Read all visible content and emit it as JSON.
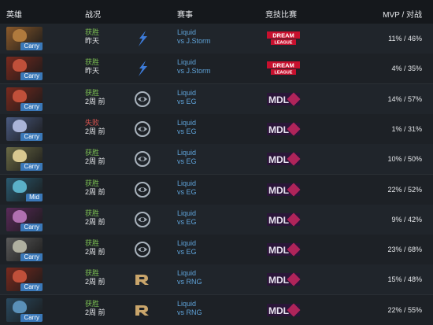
{
  "header": {
    "hero": "英雄",
    "record": "战况",
    "event": "赛事",
    "match": "竞技比赛",
    "mvp": "MVP / 对战"
  },
  "rows": [
    {
      "role": "Carry",
      "result": "获胜",
      "result_type": "win",
      "date": "昨天",
      "team": "Liquid",
      "vs": "vs J.Storm",
      "league": "dream-league",
      "mvp": "11% / 46%",
      "hero_color": "#8b5a2b",
      "face_color": "#b07a3d",
      "team_icon": "jstorm"
    },
    {
      "role": "Carry",
      "result": "获胜",
      "result_type": "win",
      "date": "昨天",
      "team": "Liquid",
      "vs": "vs J.Storm",
      "league": "dream-league",
      "mvp": "4% / 35%",
      "hero_color": "#7a2a1e",
      "face_color": "#c0503a",
      "team_icon": "jstorm"
    },
    {
      "role": "Carry",
      "result": "获胜",
      "result_type": "win",
      "date": "2周 前",
      "team": "Liquid",
      "vs": "vs EG",
      "league": "mdl",
      "mvp": "14% / 57%",
      "hero_color": "#7a2a1e",
      "face_color": "#c0503a",
      "team_icon": "eg"
    },
    {
      "role": "Carry",
      "result": "失败",
      "result_type": "loss",
      "date": "2周 前",
      "team": "Liquid",
      "vs": "vs EG",
      "league": "mdl",
      "mvp": "1% / 31%",
      "hero_color": "#4a5a80",
      "face_color": "#aab4d8",
      "team_icon": "eg"
    },
    {
      "role": "Carry",
      "result": "获胜",
      "result_type": "win",
      "date": "2周 前",
      "team": "Liquid",
      "vs": "vs EG",
      "league": "mdl",
      "mvp": "10% / 50%",
      "hero_color": "#6a6a45",
      "face_color": "#d8c890",
      "team_icon": "eg"
    },
    {
      "role": "Mid",
      "result": "获胜",
      "result_type": "win",
      "date": "2周 前",
      "team": "Liquid",
      "vs": "vs EG",
      "league": "mdl",
      "mvp": "22% / 52%",
      "hero_color": "#2a5a70",
      "face_color": "#5ab0c8",
      "team_icon": "eg"
    },
    {
      "role": "Carry",
      "result": "获胜",
      "result_type": "win",
      "date": "2周 前",
      "team": "Liquid",
      "vs": "vs EG",
      "league": "mdl",
      "mvp": "9% / 42%",
      "hero_color": "#5a2a5a",
      "face_color": "#b070b0",
      "team_icon": "eg"
    },
    {
      "role": "Carry",
      "result": "获胜",
      "result_type": "win",
      "date": "2周 前",
      "team": "Liquid",
      "vs": "vs EG",
      "league": "mdl",
      "mvp": "23% / 68%",
      "hero_color": "#5a5a5a",
      "face_color": "#b0b0a0",
      "team_icon": "eg"
    },
    {
      "role": "Carry",
      "result": "获胜",
      "result_type": "win",
      "date": "2周 前",
      "team": "Liquid",
      "vs": "vs RNG",
      "league": "mdl",
      "mvp": "15% / 48%",
      "hero_color": "#7a2a1e",
      "face_color": "#c0503a",
      "team_icon": "rng"
    },
    {
      "role": "Carry",
      "result": "获胜",
      "result_type": "win",
      "date": "2周 前",
      "team": "Liquid",
      "vs": "vs RNG",
      "league": "mdl",
      "mvp": "22% / 55%",
      "hero_color": "#2a4a60",
      "face_color": "#5a90b8",
      "team_icon": "rng"
    }
  ]
}
